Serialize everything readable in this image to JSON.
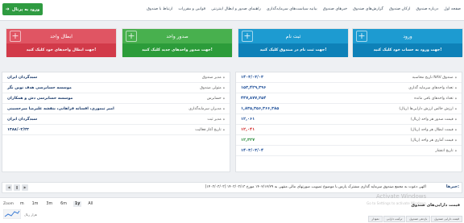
{
  "portal_button": {
    "label": "ورود به پرتال"
  },
  "nav": {
    "items": [
      "صفحه اول",
      "درباره صندوق",
      "ارکان صندوق",
      "گزارش‌های صندوق",
      "خبرهای صندوق",
      "بیانیه سیاست‌های سرمایه‌گذاری",
      "راهنمای صدور و ابطال اینترنتی",
      "قوانین و مقررات",
      "ارتباط با صندوق"
    ]
  },
  "cards": {
    "login": {
      "title": "ورود",
      "subtitle": "جهت ورود به حساب خود کلیک کنید!"
    },
    "register": {
      "title": "ثبت نام",
      "subtitle": "جهت ثبت نام در صندوق کلیک کنید!"
    },
    "issue": {
      "title": "صدور واحد",
      "subtitle": "جهت صدور واحدهای جدید کلیک کنید!"
    },
    "redeem": {
      "title": "ابطال واحد",
      "subtitle": "جهت ابطال واحدهای خود کلیک کنید!"
    }
  },
  "stats_right": [
    {
      "label": "تاریخ محاسبه NAV صندوق",
      "value": "۱۴۰۳/۰۳/۰۳",
      "color": "#1e4f99"
    },
    {
      "label": "تعداد واحدهای سرمایه گذاری",
      "value": "۱۵۳,۴۲۹,۳۹۶",
      "color": "#1e4f99"
    },
    {
      "label": "تعداد واحدهای باقی مانده",
      "value": "۴۴۷,۸۷۷,۲۵۴",
      "color": "#1e4f99"
    },
    {
      "label": "ارزش خالص ارزش دارایی‌ها (ریال)",
      "value": "۱,۸۳۵,۳۵۶,۳۶۶,۳۸۵",
      "color": "#1e4f99"
    },
    {
      "label": "قیمت صدور هر واحد (ریال)",
      "value": "۱۲,۰۶۱",
      "color": "#1e4f99"
    },
    {
      "label": "قیمت ابطال هر واحد (ریال)",
      "value": "۱۲,۰۴۱",
      "color": "#d12b2b"
    },
    {
      "label": "قیمت آماری هر واحد (ریال)",
      "value": "۱۲,۳۲۷",
      "color": "#2b8c3d"
    },
    {
      "label": "تاریخ انتشار",
      "value": "۱۴۰۳/۰۳/۰۴",
      "color": "#1e4f99"
    }
  ],
  "stats_left": [
    {
      "label": "مدیر صندوق",
      "value": "سبدگردان ایران"
    },
    {
      "label": "متولی صندوق",
      "value": "موسسه حسابرسی هدف نوین نگر"
    },
    {
      "label": "حسابرس",
      "value": "موسسه حسابرسی دش و همکاران"
    },
    {
      "label": "مدیران سرمایه‌گذاری",
      "value": "امیر تیموری، افسانه فراهانی، بنفشه علیرضا میرحسینی"
    },
    {
      "label": "مدیر ثبت",
      "value": "سبدگردان ایران"
    },
    {
      "label": "تاریخ آغاز فعالیت",
      "value": "۱۳۸۸/۰۲/۲۴"
    }
  ],
  "news": {
    "tag": "خبرها:",
    "text": "[۱۴۰۳/۰۳/۰۳] اکهی دعوت به مجمع صندوق سرمایه گذاری مشترک پارس با موضوع تصویب صورتهای مالی منتهی به ۱۴۰۲/۱۲/۲۹ مورخ ۱۴۰۳/۰۳/۱۳"
  },
  "chart_controls": {
    "zoom_label": "Zoom",
    "options": [
      "m",
      "1m",
      "3m",
      "6m",
      "1y",
      "All"
    ],
    "selected": "1y",
    "subtitle": "هزار ریال"
  },
  "bottom_panel": {
    "title": "قیمت دارایی‌های صندوق",
    "tabs": [
      "قیمت دارایی صندوق",
      "بازدهی صندوق",
      "ترکیب دارایی",
      "نمودار"
    ]
  },
  "watermark": {
    "line1": "Activate Windows",
    "line2": "Go to Settings to activate Windows."
  }
}
